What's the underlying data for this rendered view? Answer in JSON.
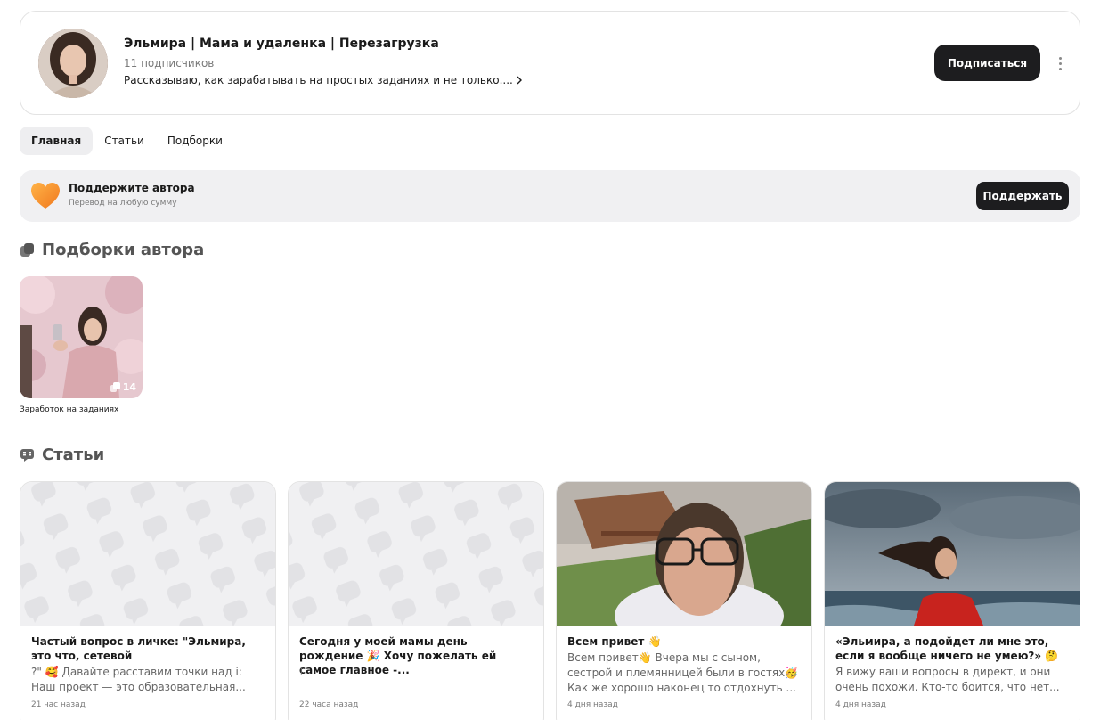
{
  "channel": {
    "title": "Эльмира | Мама и удаленка | Перезагрузка",
    "subscribers": "11 подписчиков",
    "description": "Рассказываю, как зарабатывать на простых заданиях и не только....",
    "subscribe_label": "Подписаться"
  },
  "tabs": [
    {
      "label": "Главная",
      "active": true
    },
    {
      "label": "Статьи",
      "active": false
    },
    {
      "label": "Подборки",
      "active": false
    }
  ],
  "support": {
    "title": "Поддержите автора",
    "subtitle": "Перевод на любую сумму",
    "button_label": "Поддержать"
  },
  "collections_section": {
    "heading": "Подборки автора",
    "items": [
      {
        "caption": "Заработок на заданиях",
        "count": "14"
      }
    ]
  },
  "articles_section": {
    "heading": "Статьи",
    "items": [
      {
        "title": "Частый вопрос в личке: \"Эльмира, это что, сетевой",
        "text": "?\" 🥰 Давайте расставим точки над i: Наш проект — это образовательная...",
        "time": "21 час назад",
        "thumb": "placeholder"
      },
      {
        "title": "Сегодня у моей мамы день рождение 🎉 Хочу пожелать ей самое главное -...",
        "text": "!",
        "time": "22 часа назад",
        "thumb": "placeholder"
      },
      {
        "title": "Всем привет 👋",
        "text": "Всем привет👋 Вчера мы с сыном, сестрой и племянницей были в гостях🥳 Как же хорошо наконец то отдохнуть ...",
        "time": "4 дня назад",
        "thumb": "selfie-photo"
      },
      {
        "title": "«Эльмира, а подойдет ли мне это, если я вообще ничего не умею?» 🤔",
        "text": "Я вижу ваши вопросы в директ, и они очень похожи. Кто-то боится, что нет...",
        "time": "4 дня назад",
        "thumb": "sea-photo"
      }
    ]
  },
  "colors": {
    "button_dark": "#1d1d1f",
    "support_bg": "#f0f0f2",
    "heart_orange": "#f58a1f"
  }
}
